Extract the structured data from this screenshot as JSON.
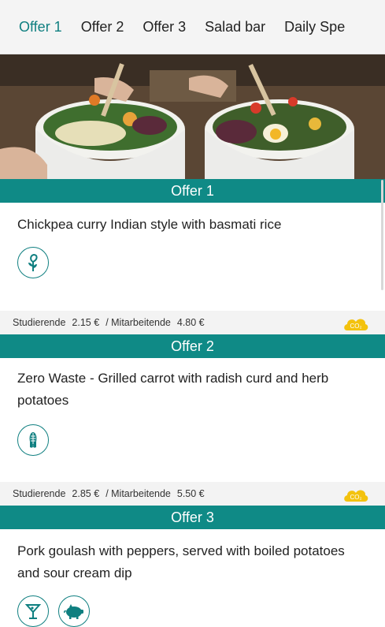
{
  "tabs": [
    {
      "label": "Offer 1",
      "active": true
    },
    {
      "label": "Offer 2",
      "active": false
    },
    {
      "label": "Offer 3",
      "active": false
    },
    {
      "label": "Salad bar",
      "active": false
    },
    {
      "label": "Daily Spe",
      "active": false
    }
  ],
  "offers": [
    {
      "title": "Offer 1",
      "dish": "Chickpea curry Indian style with basmati rice",
      "icons": [
        "vegetarian-icon"
      ],
      "student_label": "Studierende",
      "student_price": "2.15 €",
      "staff_label": "/ Mitarbeitende",
      "staff_price": "4.80 €",
      "co2_label": "CO₂"
    },
    {
      "title": "Offer 2",
      "dish": "Zero Waste - Grilled carrot with radish curd and herb potatoes",
      "icons": [
        "vegan-corn-icon"
      ],
      "student_label": "Studierende",
      "student_price": "2.85 €",
      "staff_label": "/ Mitarbeitende",
      "staff_price": "5.50 €",
      "co2_label": "CO₂"
    },
    {
      "title": "Offer 3",
      "dish": "Pork goulash with peppers, served with boiled potatoes and sour cream dip",
      "icons": [
        "alcohol-icon",
        "pork-icon"
      ]
    }
  ],
  "colors": {
    "accent": "#0f8a86",
    "co2": "#f3c20e"
  }
}
